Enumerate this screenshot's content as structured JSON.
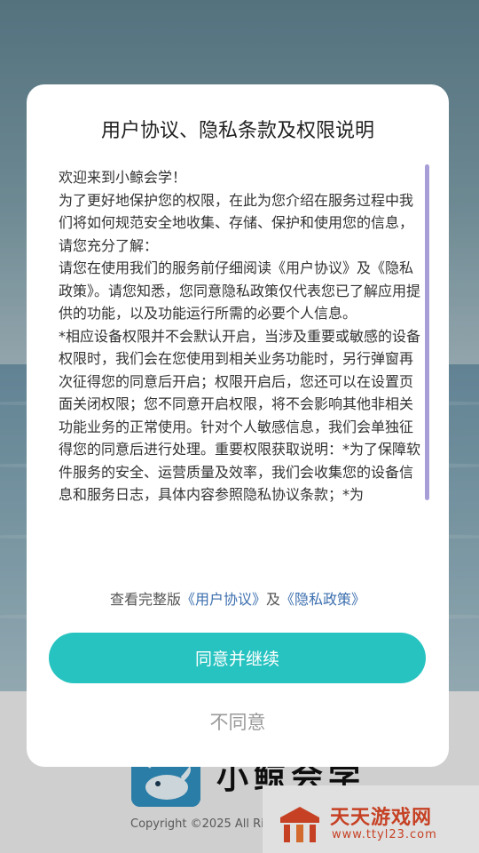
{
  "dialog": {
    "title": "用户协议、隐私条款及权限说明",
    "content": "欢迎来到小鲸会学！\n为了更好地保护您的权限，在此为您介绍在服务过程中我们将如何规范安全地收集、存储、保护和使用您的信息，请您充分了解：\n请您在使用我们的服务前仔细阅读《用户协议》及《隐私政策》。请您知悉，您同意隐私政策仅代表您已了解应用提供的功能，以及功能运行所需的必要个人信息。\n*相应设备权限并不会默认开启，当涉及重要或敏感的设备权限时，我们会在您使用到相关业务功能时，另行弹窗再次征得您的同意后开启；权限开启后，您还可以在设置页面关闭权限；您不同意开启权限，将不会影响其他非相关功能业务的正常使用。针对个人敏感信息，我们会单独征得您的同意后进行处理。重要权限获取说明：*为了保障软件服务的安全、运营质量及效率，我们会收集您的设备信息和服务日志，具体内容参照隐私协议条款；*为",
    "links_prefix": "查看完整版",
    "user_agreement_link": "《用户协议》",
    "links_and": "及",
    "privacy_policy_link": "《隐私政策》",
    "agree_label": "同意并继续",
    "disagree_label": "不同意"
  },
  "background": {
    "app_name": "小鲸会学",
    "copyright": "Copyright ©2025 All Ri"
  },
  "watermark": {
    "title": "天天游戏网",
    "url": "www.ttyl23.com"
  },
  "colors": {
    "accent": "#27c3c0",
    "link": "#3c6fae",
    "scrollbar": "#a79ed8",
    "watermark": "#e24b2a"
  }
}
